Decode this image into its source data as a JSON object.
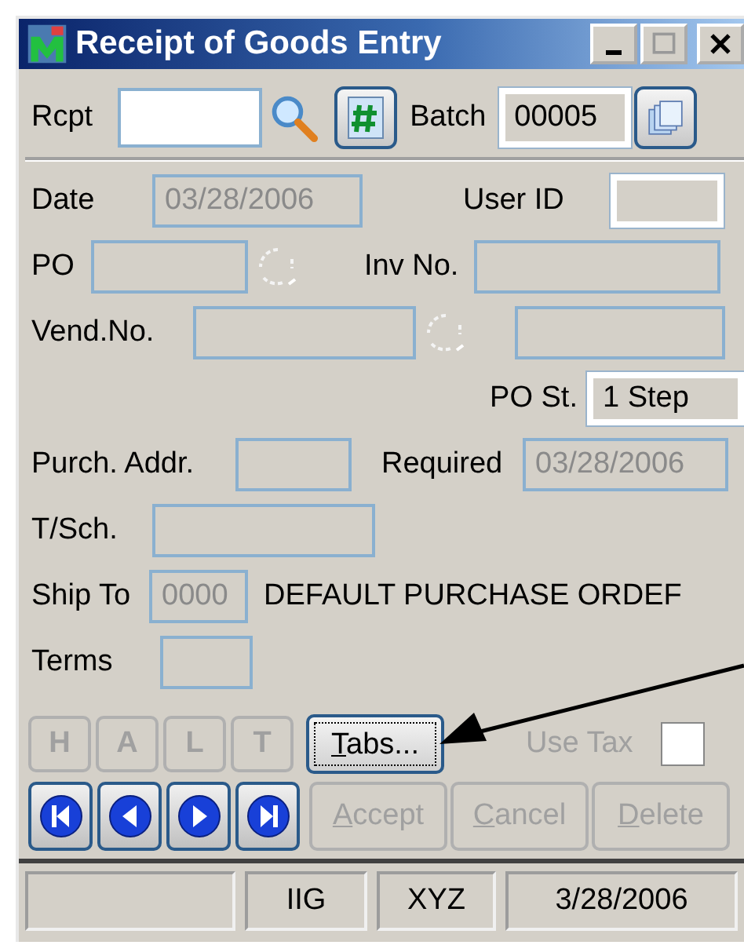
{
  "window": {
    "title": "Receipt of Goods Entry"
  },
  "header": {
    "rcpt": {
      "label": "Rcpt",
      "disabled": false,
      "editable": true
    },
    "batch": {
      "label": "Batch",
      "value": "00005",
      "disabled": false,
      "editable": false
    }
  },
  "form": {
    "date": {
      "label": "Date",
      "value": "03/28/2006",
      "disabled": true
    },
    "user_id": {
      "label": "User ID",
      "disabled": false
    },
    "po": {
      "label": "PO",
      "disabled": true
    },
    "inv_no": {
      "label": "Inv No.",
      "disabled": true
    },
    "vend_no": {
      "label": "Vend.No.",
      "disabled": true
    },
    "vend_name": {
      "disabled": true
    },
    "po_st": {
      "label": "PO St.",
      "value": "1 Step",
      "disabled": false
    },
    "purch_addr": {
      "label": "Purch. Addr.",
      "disabled": true
    },
    "required": {
      "label": "Required",
      "value": "03/28/2006",
      "disabled": true
    },
    "t_sch": {
      "label": "T/Sch.",
      "disabled": true
    },
    "ship_to": {
      "label": "Ship To",
      "value": "0000",
      "disabled": true,
      "description": "DEFAULT PURCHASE ORDEF"
    },
    "terms": {
      "label": "Terms",
      "disabled": true
    }
  },
  "halt_buttons": [
    {
      "label": "H",
      "disabled": true
    },
    {
      "label": "A",
      "disabled": true
    },
    {
      "label": "L",
      "disabled": true
    },
    {
      "label": "T",
      "disabled": true
    }
  ],
  "tabs_button": {
    "label": "Tabs...",
    "focused": true
  },
  "use_tax": {
    "label": "Use Tax",
    "disabled": true,
    "checked": false
  },
  "actions": [
    {
      "label": "Accept",
      "disabled": true
    },
    {
      "label": "Cancel",
      "disabled": true
    },
    {
      "label": "Delete",
      "disabled": true
    }
  ],
  "status_bar": [
    "IIG",
    "XYZ",
    "3/28/2006"
  ]
}
